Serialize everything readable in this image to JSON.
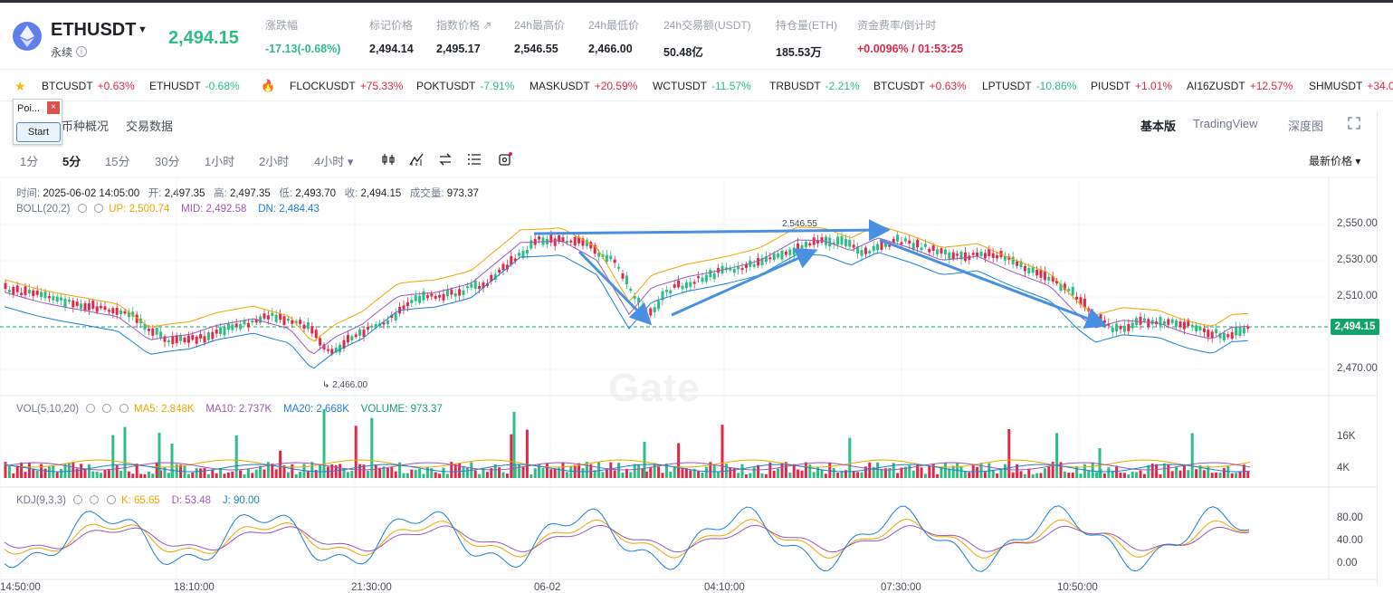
{
  "header": {
    "symbol": "ETHUSDT",
    "contract_type": "永续",
    "last_price": "2,494.15",
    "stats": [
      {
        "label": "涨跌幅",
        "value": "-17.13(-0.68%)",
        "color": "green"
      },
      {
        "label": "标记价格",
        "value": "2,494.14",
        "color": ""
      },
      {
        "label": "指数价格",
        "value": "2,495.17",
        "color": ""
      },
      {
        "label": "24h最高价",
        "value": "2,546.55",
        "color": ""
      },
      {
        "label": "24h最低价",
        "value": "2,466.00",
        "color": ""
      },
      {
        "label": "24h交易额(USDT)",
        "value": "50.48亿",
        "color": ""
      },
      {
        "label": "持仓量(ETH)",
        "value": "185.53万",
        "color": ""
      },
      {
        "label": "资金费率/倒计时",
        "value": "+0.0096% / 01:53:25",
        "color": "red"
      }
    ]
  },
  "ticker": [
    {
      "name": "BTCUSDT",
      "change": "+0.63%",
      "dir": "up"
    },
    {
      "name": "ETHUSDT",
      "change": "-0.68%",
      "dir": "down"
    },
    {
      "name": "FLOCKUSDT",
      "change": "+75.33%",
      "dir": "up"
    },
    {
      "name": "POKTUSDT",
      "change": "-7.91%",
      "dir": "down"
    },
    {
      "name": "MASKUSDT",
      "change": "+20.59%",
      "dir": "up"
    },
    {
      "name": "WCTUSDT",
      "change": "-11.57%",
      "dir": "down"
    },
    {
      "name": "TRBUSDT",
      "change": "-2.21%",
      "dir": "down"
    },
    {
      "name": "BTCUSDT",
      "change": "+0.63%",
      "dir": "up"
    },
    {
      "name": "LPTUSDT",
      "change": "-10.86%",
      "dir": "down"
    },
    {
      "name": "PIUSDT",
      "change": "+1.01%",
      "dir": "up"
    },
    {
      "name": "AI16ZUSDT",
      "change": "+12.57%",
      "dir": "up"
    },
    {
      "name": "SHMUSDT",
      "change": "+34.0",
      "dir": "up"
    }
  ],
  "popup": {
    "title": "Poi...",
    "close": "×",
    "button": "Start"
  },
  "subtabs": [
    "币种概况",
    "交易数据"
  ],
  "versions": [
    "基本版",
    "TradingView",
    "深度图"
  ],
  "intervals": [
    "1分",
    "5分",
    "15分",
    "30分",
    "1小时",
    "2小时",
    "4小时 ▾"
  ],
  "latest_price_select": "最新价格 ▾",
  "ohlc": {
    "time_label": "时间:",
    "time": "2025-06-02 14:05:00",
    "open_label": "开:",
    "open": "2,497.35",
    "high_label": "高:",
    "high": "2,497.35",
    "low_label": "低:",
    "low": "2,493.70",
    "close_label": "收:",
    "close": "2,494.15",
    "vol_label": "成交量:",
    "vol": "973.37"
  },
  "boll": {
    "name": "BOLL(20,2)",
    "up": "UP: 2,500.74",
    "mid": "MID: 2,492.58",
    "dn": "DN: 2,484.43"
  },
  "vol": {
    "name": "VOL(5,10,20)",
    "ma5": "MA5: 2.848K",
    "ma10": "MA10: 2.737K",
    "ma20": "MA20: 2.668K",
    "volume": "VOLUME: 973.37"
  },
  "kdj": {
    "name": "KDJ(9,3,3)",
    "k": "K: 65.65",
    "d": "D: 53.48",
    "j": "J: 90.00"
  },
  "price_axis": [
    "2,550.00",
    "2,530.00",
    "2,510.00",
    "2,470.00"
  ],
  "volume_axis": [
    "16K",
    "4K"
  ],
  "kdj_axis": [
    "80.00",
    "40.00",
    "0.00"
  ],
  "time_axis": [
    "14:50:00",
    "18:10:00",
    "21:30:00",
    "06-02",
    "04:10:00",
    "07:30:00",
    "10:50:00"
  ],
  "current_price_tag": "2,494.15",
  "high_marker": "2,546.55",
  "low_marker": "2,466.00",
  "watermark": "Gate",
  "colors": {
    "up": "#e0294a",
    "down": "#2ebd85",
    "boll_up": "#f0a500",
    "boll_mid": "#9b59b6",
    "boll_dn": "#1e7fd6",
    "arrow": "#4a90e2"
  }
}
